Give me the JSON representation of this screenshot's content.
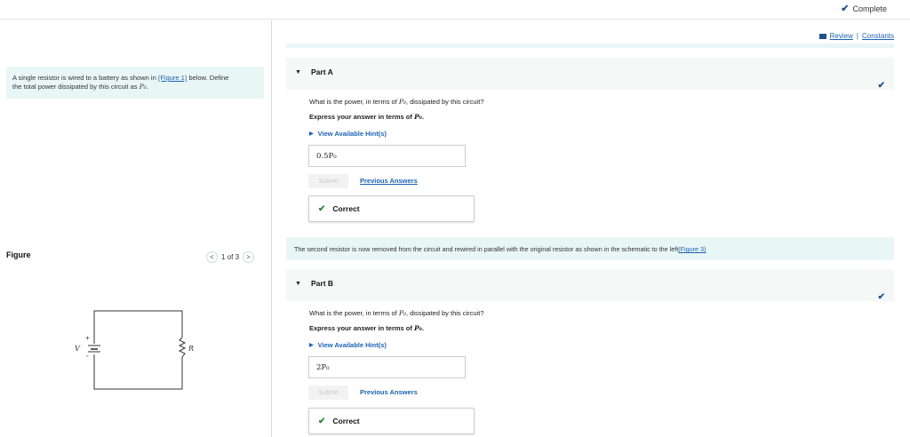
{
  "header": {
    "status_label": "Complete"
  },
  "toolbar": {
    "review_label": "Review",
    "separator": "|",
    "constants_label": "Constants"
  },
  "left": {
    "intro_text": "A single resistor is wired to a battery as shown in",
    "figure_link": "(Figure 1)",
    "intro_text_2": "below. Define",
    "intro_line2_prefix": "the total power dissipated by this circuit as",
    "p0": "P₀",
    "figure_label": "Figure",
    "pager_text": "1 of 3",
    "pager_prev": "<",
    "pager_next": ">",
    "circuit": {
      "plus": "+",
      "minus": "-",
      "voltage_label": "V",
      "resistor_label": "R"
    }
  },
  "parts": [
    {
      "title": "Part A",
      "question_prefix": "What is the power, in terms of",
      "question_suffix": ", dissipated by this circuit?",
      "express_prefix": "Express your answer in terms of",
      "hint_label": "View Available Hint(s)",
      "answer_value": "0.5P₀",
      "submit_label": "Submit",
      "previous_answers_label": "Previous Answers",
      "correct_label": "Correct"
    },
    {
      "title": "Part B",
      "question_prefix": "What is the power, in terms of",
      "question_suffix": ", dissipated by this circuit?",
      "express_prefix": "Express your answer in terms of",
      "hint_label": "View Available Hint(s)",
      "answer_value": "2P₀",
      "submit_label": "Submit",
      "previous_answers_label": "Previous Answers",
      "correct_label": "Correct"
    }
  ],
  "banner": {
    "text": "The second resistor is now removed from the circuit and rewired in parallel with the original resistor as shown in the schematic to the left",
    "link": "(Figure 3)"
  },
  "colors": {
    "accent": "#1a63b5",
    "banner_bg": "#e9f6f6",
    "correct_green": "#2e8a3a",
    "check_blue": "#1f4f8a"
  }
}
